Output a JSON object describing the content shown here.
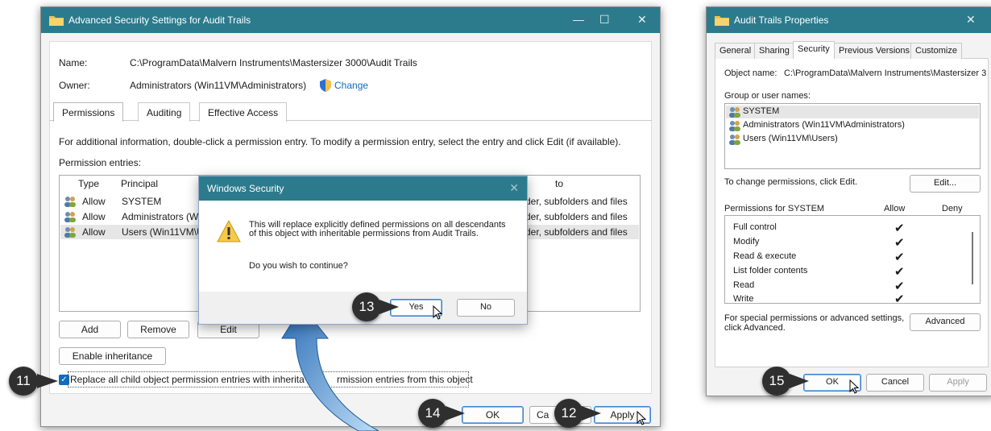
{
  "adv": {
    "title": "Advanced Security Settings for Audit Trails",
    "name_label": "Name:",
    "name_value": "C:\\ProgramData\\Malvern Instruments\\Mastersizer 3000\\Audit Trails",
    "owner_label": "Owner:",
    "owner_value": "Administrators (Win11VM\\Administrators)",
    "change_link": "Change",
    "tabs": [
      "Permissions",
      "Auditing",
      "Effective Access"
    ],
    "info_text": "For additional information, double-click a permission entry. To modify a permission entry, select the entry and click Edit (if available).",
    "entries_label": "Permission entries:",
    "columns": [
      "Type",
      "Principal",
      "to"
    ],
    "rows": [
      {
        "type": "Allow",
        "principal": "SYSTEM",
        "applies": "der, subfolders and files"
      },
      {
        "type": "Allow",
        "principal": "Administrators (W",
        "applies": "der, subfolders and files"
      },
      {
        "type": "Allow",
        "principal": "Users (Win11VM\\U",
        "applies": "der, subfolders and files"
      }
    ],
    "buttons": {
      "add": "Add",
      "remove": "Remove",
      "edit": "Edit",
      "enable_inheritance": "Enable inheritance",
      "ok": "OK",
      "cancel": "Ca",
      "apply": "Apply"
    },
    "replace_checkbox": "Replace all child object permission entries with inherita",
    "replace_checkbox_tail": "rmission entries from this object"
  },
  "dialog": {
    "title": "Windows Security",
    "message": "This will replace explicitly defined permissions on all descendants of this object with inheritable permissions from Audit Trails.",
    "question": "Do you wish to continue?",
    "yes": "Yes",
    "no": "No"
  },
  "props": {
    "title": "Audit Trails Properties",
    "tabs": [
      "General",
      "Sharing",
      "Security",
      "Previous Versions",
      "Customize"
    ],
    "object_label": "Object name:",
    "object_value": "C:\\ProgramData\\Malvern Instruments\\Mastersizer 3",
    "group_label": "Group or user names:",
    "groups": [
      "SYSTEM",
      "Administrators (Win11VM\\Administrators)",
      "Users (Win11VM\\Users)"
    ],
    "change_text": "To change permissions, click Edit.",
    "edit": "Edit...",
    "perm_for": "Permissions for SYSTEM",
    "allow": "Allow",
    "deny": "Deny",
    "perms": [
      "Full control",
      "Modify",
      "Read & execute",
      "List folder contents",
      "Read",
      "Write"
    ],
    "special_text": "For special permissions or advanced settings, click Advanced.",
    "advanced": "Advanced",
    "ok": "OK",
    "cancel": "Cancel",
    "apply": "Apply"
  },
  "steps": {
    "s11": "11",
    "s12": "12",
    "s13": "13",
    "s14": "14",
    "s15": "15"
  },
  "colors": {
    "titlebar": "#2c7b8d",
    "accent": "#0f6cbd",
    "arrow": "#5fa6dc",
    "badge": "#2f2f2f"
  }
}
